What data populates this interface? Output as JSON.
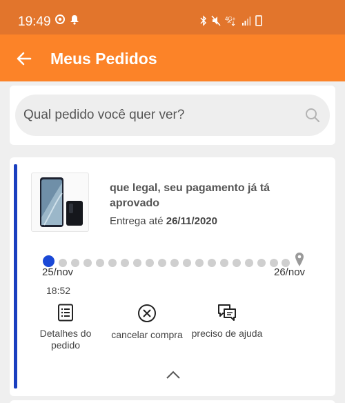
{
  "status_bar": {
    "time": "19:49",
    "icons": [
      "chrome-icon",
      "notification-icon",
      "bluetooth-icon",
      "mute-icon",
      "network-4g-icon",
      "signal-icon",
      "battery-icon"
    ]
  },
  "app_bar": {
    "title": "Meus Pedidos",
    "back_icon": "arrow-left-icon"
  },
  "search": {
    "placeholder": "Qual pedido você quer ver?",
    "icon": "search-icon"
  },
  "order": {
    "status_title": "que legal, seu pagamento já tá aprovado",
    "delivery_label": "Entrega até",
    "delivery_date": "26/11/2020",
    "timeline": {
      "start_label": "25/nov",
      "start_time": "18:52",
      "end_label": "26/nov"
    },
    "actions": [
      {
        "label": "Detalhes do pedido",
        "icon": "list-icon"
      },
      {
        "label": "cancelar compra",
        "icon": "cancel-circle-icon"
      },
      {
        "label": "preciso de ajuda",
        "icon": "chat-icon"
      }
    ]
  },
  "colors": {
    "status_bar": "#e2752c",
    "app_bar": "#fc8328",
    "accent": "#1a3fbf",
    "timeline_active": "#1a48d6",
    "timeline_pending": "#cfcfcf"
  }
}
